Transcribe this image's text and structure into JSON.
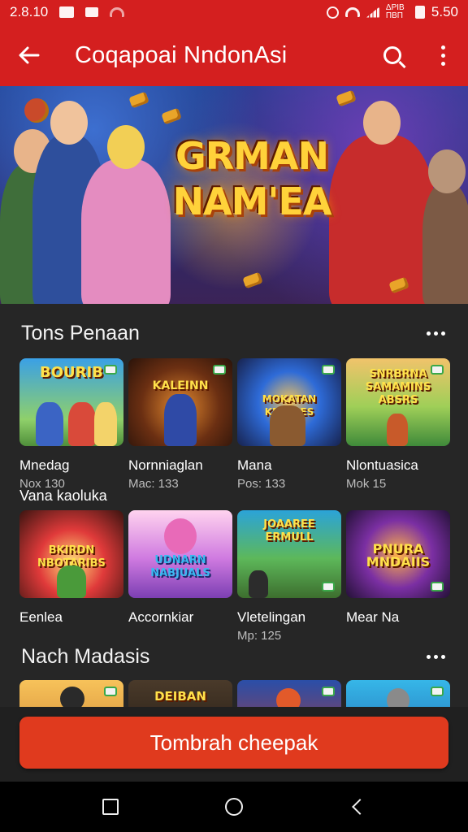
{
  "status_bar": {
    "time": "2.8.10",
    "network_text": "ΔΡΙΒ ΠΒΠ",
    "battery_time": "5.50"
  },
  "app_bar": {
    "title": "Coqapoai NndonAsi",
    "back_icon": "arrow-left-icon",
    "search_icon": "search-icon",
    "menu_icon": "more-vert-icon"
  },
  "banner": {
    "title_line1": "GRMAN",
    "title_line2": "NAM'EA"
  },
  "section1": {
    "title": "Tons Penaan",
    "sub_label": "Vana kaoluka",
    "row1": [
      {
        "thumb_text": "BOURIB",
        "name": "Mnedag",
        "meta": "Nox 130"
      },
      {
        "thumb_text": "KALEINN",
        "name": "Nornniaglan",
        "meta": "Mac: 133"
      },
      {
        "thumb_text": "MOKATAN KEFANES",
        "name": "Mana",
        "meta": "Pos: 133"
      },
      {
        "thumb_text": "SNRBRNA SAMAMINS ABSRS",
        "name": "Nlontuasica",
        "meta": "Mok 15"
      }
    ],
    "row2": [
      {
        "thumb_text": "BKIRDN NBOTARIBS",
        "name": "Eenlea",
        "meta": ""
      },
      {
        "thumb_text": "UDNARN NABJUALS",
        "name": "Accornkiar",
        "meta": ""
      },
      {
        "thumb_text": "JOAAREE ERMULL",
        "name": "Vletelingan",
        "meta": "Mp: 125"
      },
      {
        "thumb_text": "PNURA MNDAIIS",
        "name": "Mear Na",
        "meta": ""
      }
    ]
  },
  "section2": {
    "title": "Nach Madasis",
    "row": [
      {
        "thumb_text": ""
      },
      {
        "thumb_text": "DEIBAN"
      },
      {
        "thumb_text": ""
      },
      {
        "thumb_text": ""
      }
    ]
  },
  "cta": {
    "label": "Tombrah cheepak"
  },
  "colors": {
    "accent": "#d41f1f",
    "cta": "#e03a1e",
    "background": "#262626"
  }
}
